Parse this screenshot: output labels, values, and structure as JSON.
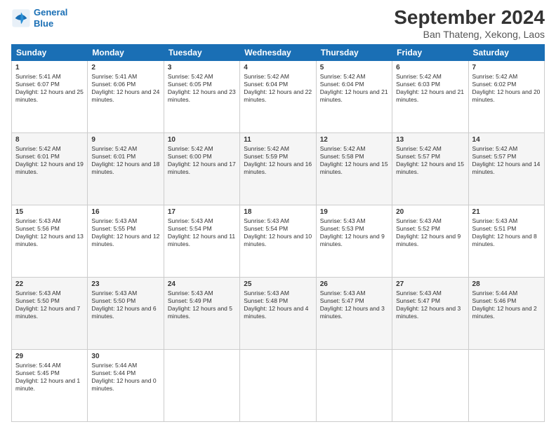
{
  "logo": {
    "line1": "General",
    "line2": "Blue"
  },
  "title": "September 2024",
  "subtitle": "Ban Thateng, Xekong, Laos",
  "days": [
    "Sunday",
    "Monday",
    "Tuesday",
    "Wednesday",
    "Thursday",
    "Friday",
    "Saturday"
  ],
  "weeks": [
    [
      {
        "day": 1,
        "sunrise": "5:41 AM",
        "sunset": "6:07 PM",
        "daylight": "12 hours and 25 minutes."
      },
      {
        "day": 2,
        "sunrise": "5:41 AM",
        "sunset": "6:06 PM",
        "daylight": "12 hours and 24 minutes."
      },
      {
        "day": 3,
        "sunrise": "5:42 AM",
        "sunset": "6:05 PM",
        "daylight": "12 hours and 23 minutes."
      },
      {
        "day": 4,
        "sunrise": "5:42 AM",
        "sunset": "6:04 PM",
        "daylight": "12 hours and 22 minutes."
      },
      {
        "day": 5,
        "sunrise": "5:42 AM",
        "sunset": "6:04 PM",
        "daylight": "12 hours and 21 minutes."
      },
      {
        "day": 6,
        "sunrise": "5:42 AM",
        "sunset": "6:03 PM",
        "daylight": "12 hours and 21 minutes."
      },
      {
        "day": 7,
        "sunrise": "5:42 AM",
        "sunset": "6:02 PM",
        "daylight": "12 hours and 20 minutes."
      }
    ],
    [
      {
        "day": 8,
        "sunrise": "5:42 AM",
        "sunset": "6:01 PM",
        "daylight": "12 hours and 19 minutes."
      },
      {
        "day": 9,
        "sunrise": "5:42 AM",
        "sunset": "6:01 PM",
        "daylight": "12 hours and 18 minutes."
      },
      {
        "day": 10,
        "sunrise": "5:42 AM",
        "sunset": "6:00 PM",
        "daylight": "12 hours and 17 minutes."
      },
      {
        "day": 11,
        "sunrise": "5:42 AM",
        "sunset": "5:59 PM",
        "daylight": "12 hours and 16 minutes."
      },
      {
        "day": 12,
        "sunrise": "5:42 AM",
        "sunset": "5:58 PM",
        "daylight": "12 hours and 15 minutes."
      },
      {
        "day": 13,
        "sunrise": "5:42 AM",
        "sunset": "5:57 PM",
        "daylight": "12 hours and 15 minutes."
      },
      {
        "day": 14,
        "sunrise": "5:42 AM",
        "sunset": "5:57 PM",
        "daylight": "12 hours and 14 minutes."
      }
    ],
    [
      {
        "day": 15,
        "sunrise": "5:43 AM",
        "sunset": "5:56 PM",
        "daylight": "12 hours and 13 minutes."
      },
      {
        "day": 16,
        "sunrise": "5:43 AM",
        "sunset": "5:55 PM",
        "daylight": "12 hours and 12 minutes."
      },
      {
        "day": 17,
        "sunrise": "5:43 AM",
        "sunset": "5:54 PM",
        "daylight": "12 hours and 11 minutes."
      },
      {
        "day": 18,
        "sunrise": "5:43 AM",
        "sunset": "5:54 PM",
        "daylight": "12 hours and 10 minutes."
      },
      {
        "day": 19,
        "sunrise": "5:43 AM",
        "sunset": "5:53 PM",
        "daylight": "12 hours and 9 minutes."
      },
      {
        "day": 20,
        "sunrise": "5:43 AM",
        "sunset": "5:52 PM",
        "daylight": "12 hours and 9 minutes."
      },
      {
        "day": 21,
        "sunrise": "5:43 AM",
        "sunset": "5:51 PM",
        "daylight": "12 hours and 8 minutes."
      }
    ],
    [
      {
        "day": 22,
        "sunrise": "5:43 AM",
        "sunset": "5:50 PM",
        "daylight": "12 hours and 7 minutes."
      },
      {
        "day": 23,
        "sunrise": "5:43 AM",
        "sunset": "5:50 PM",
        "daylight": "12 hours and 6 minutes."
      },
      {
        "day": 24,
        "sunrise": "5:43 AM",
        "sunset": "5:49 PM",
        "daylight": "12 hours and 5 minutes."
      },
      {
        "day": 25,
        "sunrise": "5:43 AM",
        "sunset": "5:48 PM",
        "daylight": "12 hours and 4 minutes."
      },
      {
        "day": 26,
        "sunrise": "5:43 AM",
        "sunset": "5:47 PM",
        "daylight": "12 hours and 3 minutes."
      },
      {
        "day": 27,
        "sunrise": "5:43 AM",
        "sunset": "5:47 PM",
        "daylight": "12 hours and 3 minutes."
      },
      {
        "day": 28,
        "sunrise": "5:44 AM",
        "sunset": "5:46 PM",
        "daylight": "12 hours and 2 minutes."
      }
    ],
    [
      {
        "day": 29,
        "sunrise": "5:44 AM",
        "sunset": "5:45 PM",
        "daylight": "12 hours and 1 minute."
      },
      {
        "day": 30,
        "sunrise": "5:44 AM",
        "sunset": "5:44 PM",
        "daylight": "12 hours and 0 minutes."
      },
      null,
      null,
      null,
      null,
      null
    ]
  ]
}
